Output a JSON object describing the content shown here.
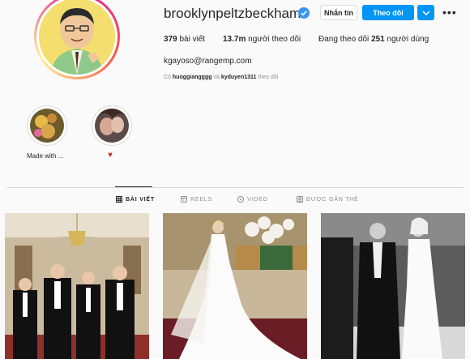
{
  "profile": {
    "username": "brooklynpeltzbeckham",
    "message_button": "Nhắn tin",
    "follow_button": "Theo dõi",
    "posts_count": "379",
    "posts_label": "bài viết",
    "followers_count": "13.7m",
    "followers_label": "người theo dõi",
    "following_prefix": "Đang theo dõi",
    "following_count": "251",
    "following_label": "người dùng",
    "email": "kgayoso@rangemp.com",
    "followed_by_prefix": "Có",
    "followed_by_user1": "huoggiangggg",
    "followed_by_and": "và",
    "followed_by_user2": "kyduyen1311",
    "followed_by_suffix": "theo dõi"
  },
  "highlights": [
    {
      "label": "Made with ..."
    },
    {
      "label": "♥"
    }
  ],
  "tabs": [
    {
      "label": "BÀI VIẾT",
      "icon": "grid-icon",
      "active": true
    },
    {
      "label": "REELS",
      "icon": "reels-icon",
      "active": false
    },
    {
      "label": "VIDEO",
      "icon": "video-icon",
      "active": false
    },
    {
      "label": "ĐƯỢC GẮN THẺ",
      "icon": "tagged-icon",
      "active": false
    }
  ],
  "colors": {
    "accent": "#0095f6",
    "verified": "#3897f0",
    "heart": "#c0392b"
  }
}
